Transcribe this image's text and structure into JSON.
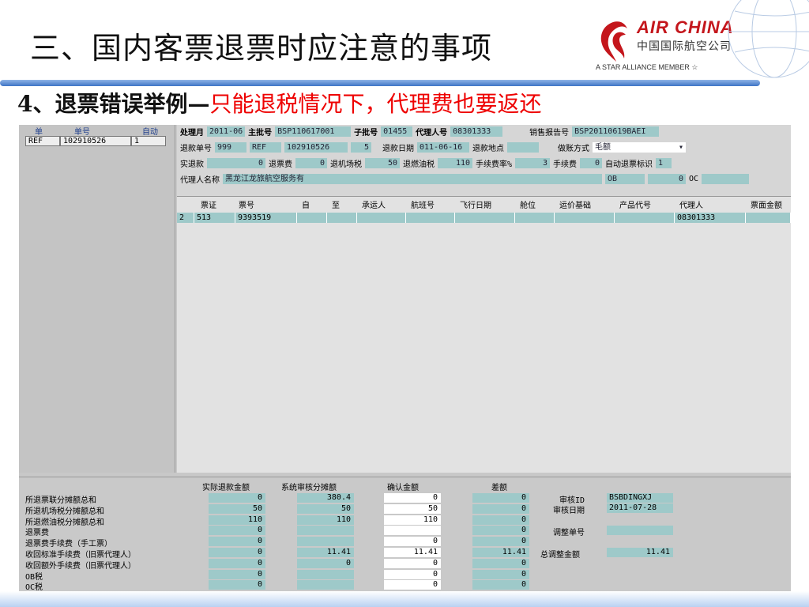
{
  "slide": {
    "title": "三、国内客票退票时应注意的事项",
    "subtitle_black": "4、退票错误举例—",
    "subtitle_red": "只能退税情况下，代理费也要返还"
  },
  "logo": {
    "brand": "AIR CHINA",
    "cn": "中国国际航空公司",
    "alliance": "A STAR ALLIANCE MEMBER ☆"
  },
  "left_pane": {
    "headers": [
      "单",
      "单号",
      "自动"
    ],
    "row": [
      "REF",
      "102910526",
      "1"
    ]
  },
  "form": {
    "line1": [
      {
        "label": "处理月",
        "bold": true,
        "value": "2011-06"
      },
      {
        "label": "主批号",
        "bold": true,
        "value": "BSP110617001"
      },
      {
        "label": "子批号",
        "bold": true,
        "value": "01455"
      },
      {
        "label": "代理人号",
        "bold": true,
        "value": "08301333"
      },
      {
        "label": "销售报告号",
        "bold": false,
        "value": "BSP20110619BAEI"
      }
    ],
    "line2": [
      {
        "label": "退款单号",
        "value": "999"
      },
      {
        "label": "",
        "value": "REF"
      },
      {
        "label": "",
        "value": "102910526"
      },
      {
        "label": "",
        "value": "5"
      },
      {
        "label": "退款日期",
        "value": "011-06-16"
      },
      {
        "label": "退款地点",
        "value": ""
      },
      {
        "label": "做账方式",
        "value": "毛额"
      }
    ],
    "line3": [
      {
        "label": "实退款",
        "value": "0"
      },
      {
        "label": "退票费",
        "value": "0"
      },
      {
        "label": "退机场税",
        "value": "50"
      },
      {
        "label": "退燃油税",
        "value": "110"
      },
      {
        "label": "手续费率%",
        "value": "3"
      },
      {
        "label": "手续费",
        "value": "0"
      },
      {
        "label": "自动退票标识",
        "value": "1"
      }
    ],
    "line4": [
      {
        "label": "代理人名称",
        "value": "黑龙江龙旅航空服务有"
      },
      {
        "label": "",
        "value": "OB"
      },
      {
        "label": "",
        "value": "0"
      },
      {
        "label": "OC",
        "value": ""
      }
    ]
  },
  "grid": {
    "headers": [
      "票证",
      "票号",
      "自",
      "至",
      "承运人",
      "航班号",
      "飞行日期",
      "舱位",
      "运价基础",
      "产品代号",
      "代理人",
      "票面金额"
    ],
    "row": [
      "2",
      "513",
      "9393519",
      "",
      "",
      "",
      "",
      "",
      "",
      "",
      "",
      "08301333",
      ""
    ]
  },
  "bottom": {
    "col_headers": [
      "实际退款金额",
      "系统审核分摊额",
      "确认金额",
      "差额"
    ],
    "rows": [
      {
        "label": "所退票联分摊额总和",
        "v": [
          "0",
          "380.4",
          "0",
          "0"
        ]
      },
      {
        "label": "所退机场税分摊额总和",
        "v": [
          "50",
          "50",
          "50",
          "0"
        ]
      },
      {
        "label": "所退燃油税分摊额总和",
        "v": [
          "110",
          "110",
          "110",
          "0"
        ]
      },
      {
        "label": "退票费",
        "v": [
          "0",
          "",
          "",
          "0"
        ]
      },
      {
        "label": "退票费手续费（手工票）",
        "v": [
          "0",
          "",
          "0",
          "0"
        ]
      },
      {
        "label": "收回标准手续费（旧票代理人）",
        "v": [
          "0",
          "11.41",
          "11.41",
          "11.41"
        ]
      },
      {
        "label": "收回额外手续费（旧票代理人）",
        "v": [
          "0",
          "0",
          "0",
          "0"
        ]
      },
      {
        "label": "OB税",
        "v": [
          "0",
          "",
          "0",
          "0"
        ]
      },
      {
        "label": "OC税",
        "v": [
          "0",
          "",
          "0",
          "0"
        ]
      }
    ],
    "audit_id_label": "审核ID",
    "audit_id": "BSBDINGXJ",
    "audit_date_label": "审核日期",
    "audit_date": "2011-07-28",
    "adjust_no_label": "调整单号",
    "adjust_no": "",
    "total_adjust_label": "总调整金额",
    "total_adjust": "11.41"
  },
  "colors": {
    "field": "#9ec9c9",
    "accent_red": "#e00",
    "brand_red": "#c4161c",
    "rule_blue": "#3e74c6"
  }
}
